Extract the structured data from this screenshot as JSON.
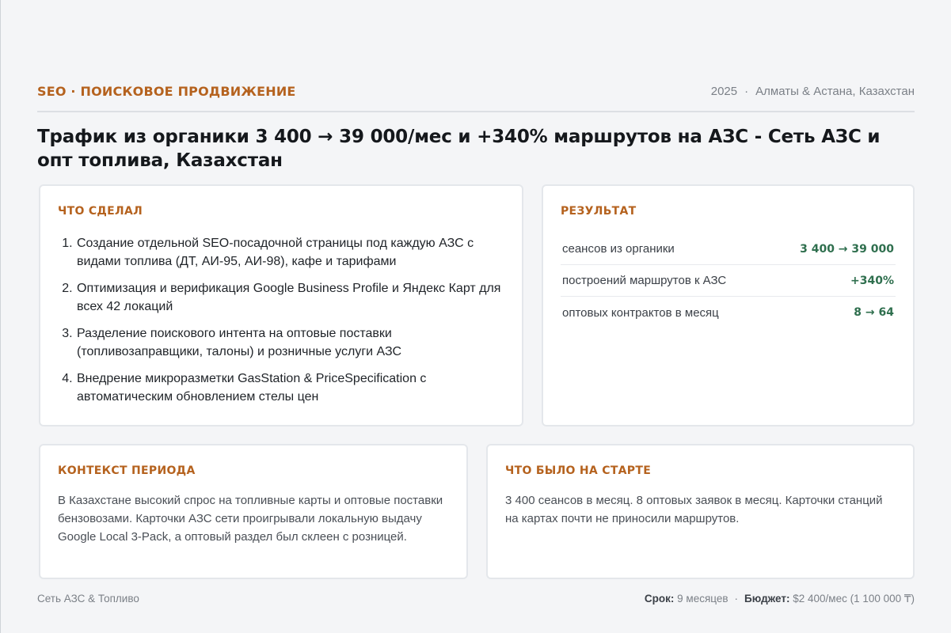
{
  "header": {
    "eyebrow": "SEO · ПОИСКОВОЕ ПРОДВИЖЕНИЕ",
    "year": "2025",
    "separator": "·",
    "location": "Алматы & Астана, Казахстан"
  },
  "title": "Трафик из органики 3 400 → 39 000/мес и +340% маршрутов на АЗС - Сеть АЗС и опт топлива, Казахстан",
  "what_done": {
    "label": "ЧТО СДЕЛАЛ",
    "items": [
      "Создание отдельной SEO-посадочной страницы под каждую АЗС с видами топлива (ДТ, АИ-95, АИ-98), кафе и тарифами",
      "Оптимизация и верификация Google Business Profile и Яндекс Карт для всех 42 локаций",
      "Разделение поискового интента на оптовые поставки (топливозаправщики, талоны) и розничные услуги АЗС",
      "Внедрение микроразметки GasStation & PriceSpecification с автоматическим обновлением стелы цен"
    ]
  },
  "result": {
    "label": "РЕЗУЛЬТАТ",
    "rows": [
      {
        "label": "сеансов из органики",
        "value": "3 400 → 39 000"
      },
      {
        "label": "построений маршрутов к АЗС",
        "value": "+340%"
      },
      {
        "label": "оптовых контрактов в месяц",
        "value": "8 → 64"
      }
    ]
  },
  "context": {
    "label": "КОНТЕКСТ ПЕРИОДА",
    "text": "В Казахстане высокий спрос на топливные карты и оптовые поставки бензовозами. Карточки АЗС сети проигрывали локальную выдачу Google Local 3-Pack, а оптовый раздел был склеен с розницей."
  },
  "start": {
    "label": "ЧТО БЫЛО НА СТАРТЕ",
    "text": "3 400 сеансов в месяц. 8 оптовых заявок в месяц. Карточки станций на картах почти не приносили маршрутов."
  },
  "footer": {
    "category": "Сеть АЗС & Топливо",
    "term_label": "Срок:",
    "term_value": "9 месяцев",
    "separator": "·",
    "budget_label": "Бюджет:",
    "budget_value": "$2 400/мес (1 100 000 ₸)"
  },
  "colors": {
    "accent": "#b5621e",
    "positive": "#2f6f4e",
    "background": "#f4f5f7"
  }
}
